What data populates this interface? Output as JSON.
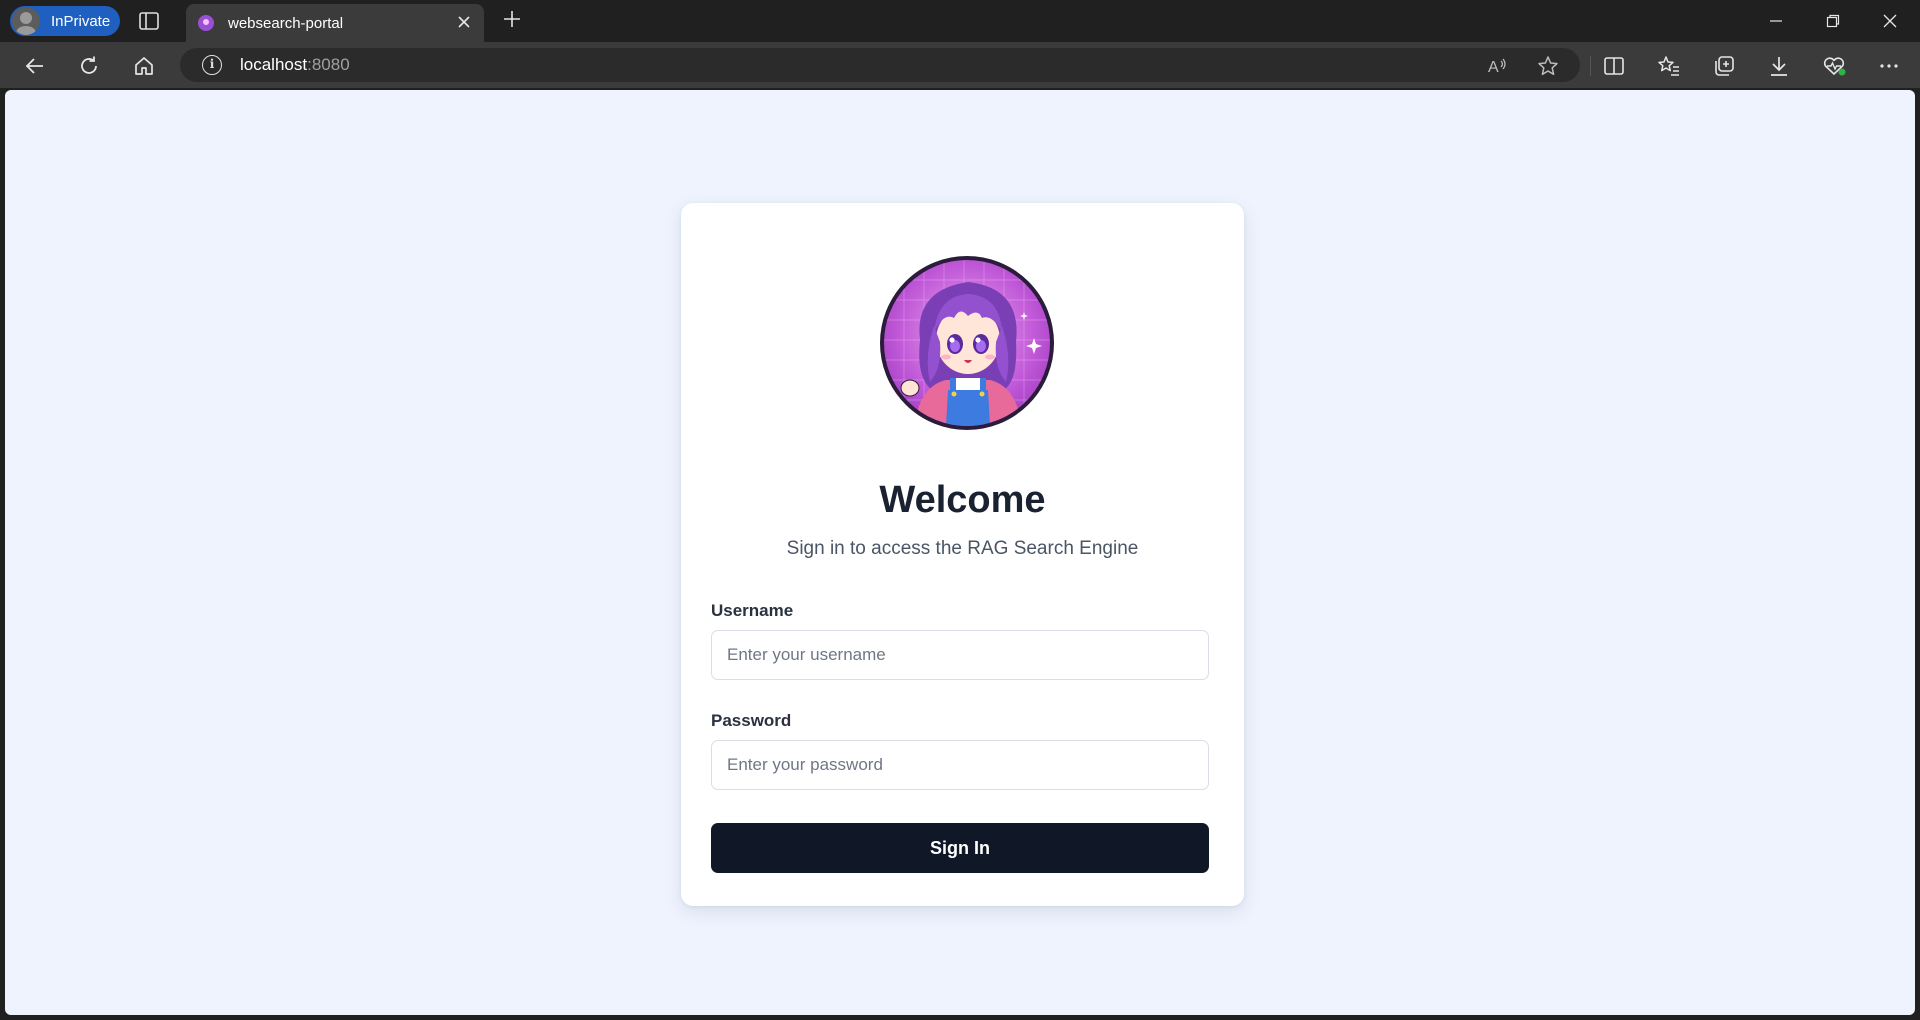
{
  "browser": {
    "profile_label": "InPrivate",
    "tab_title": "websearch-portal",
    "url_host": "localhost",
    "url_port": ":8080",
    "icons": {
      "tab_actions": "tab-actions-icon",
      "favicon": "site-favicon-icon",
      "tab_close": "close-icon",
      "new_tab": "plus-icon",
      "back": "back-arrow-icon",
      "refresh": "refresh-icon",
      "home": "home-icon",
      "site_info": "info-icon",
      "read_aloud": "read-aloud-icon",
      "favorite": "star-icon",
      "split_screen": "split-screen-icon",
      "favorites": "favorites-icon",
      "collections": "collections-icon",
      "downloads": "download-icon",
      "browser_essentials": "heart-pulse-icon",
      "more": "more-icon",
      "minimize": "minimize-icon",
      "restore": "restore-icon",
      "close_window": "close-window-icon"
    }
  },
  "login": {
    "title": "Welcome",
    "subtitle": "Sign in to access the RAG Search Engine",
    "username_label": "Username",
    "username_placeholder": "Enter your username",
    "username_value": "",
    "password_label": "Password",
    "password_placeholder": "Enter your password",
    "password_value": "",
    "submit_label": "Sign In"
  },
  "colors": {
    "page_background": "#eef3fd",
    "card": "#ffffff",
    "button": "#101828",
    "inprivate_badge": "#1f5fbf",
    "avatar_accent": "#c159d8"
  }
}
